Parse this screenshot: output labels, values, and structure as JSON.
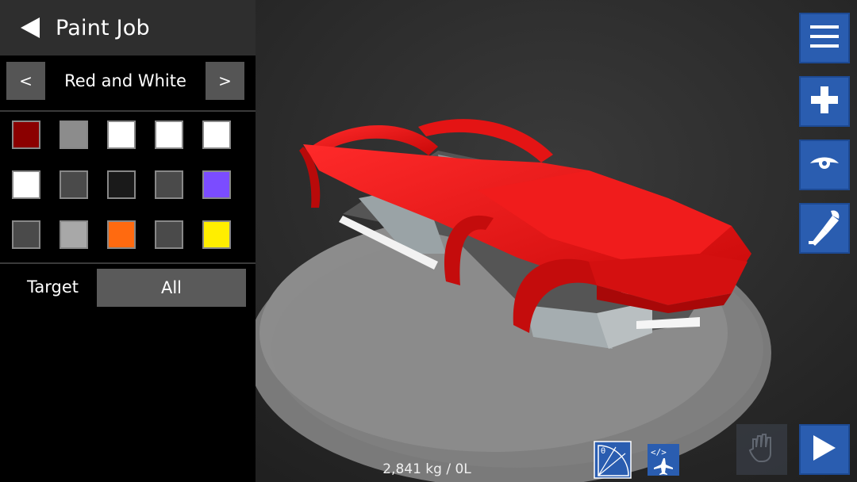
{
  "header": {
    "title": "Paint Job"
  },
  "scheme": {
    "name": "Red and White",
    "prev_label": "<",
    "next_label": ">"
  },
  "swatches": [
    {
      "color": "#8b0000"
    },
    {
      "color": "#8c8c8c"
    },
    {
      "color": "#ffffff"
    },
    {
      "color": "#ffffff"
    },
    {
      "color": "#ffffff"
    },
    {
      "color": "#ffffff"
    },
    {
      "color": "#4a4a4a"
    },
    {
      "color": "#1a1a1a"
    },
    {
      "color": "#4a4a4a"
    },
    {
      "color": "#7b4cff"
    },
    {
      "color": "#4a4a4a"
    },
    {
      "color": "#a8a8a8"
    },
    {
      "color": "#ff6a10"
    },
    {
      "color": "#4a4a4a"
    },
    {
      "color": "#ffee00"
    }
  ],
  "target": {
    "label": "Target",
    "value": "All"
  },
  "status": {
    "mass_fuel": "2,841 kg / 0L"
  },
  "toolbar": {
    "icons": [
      "menu-icon",
      "plus-icon",
      "eye-icon",
      "paint-brush-icon",
      "hand-icon",
      "play-icon",
      "angle-quadrant-icon",
      "code-plane-icon"
    ]
  },
  "colors": {
    "toolbar_blue": "#2a5db0",
    "car_red": "#e01010"
  }
}
